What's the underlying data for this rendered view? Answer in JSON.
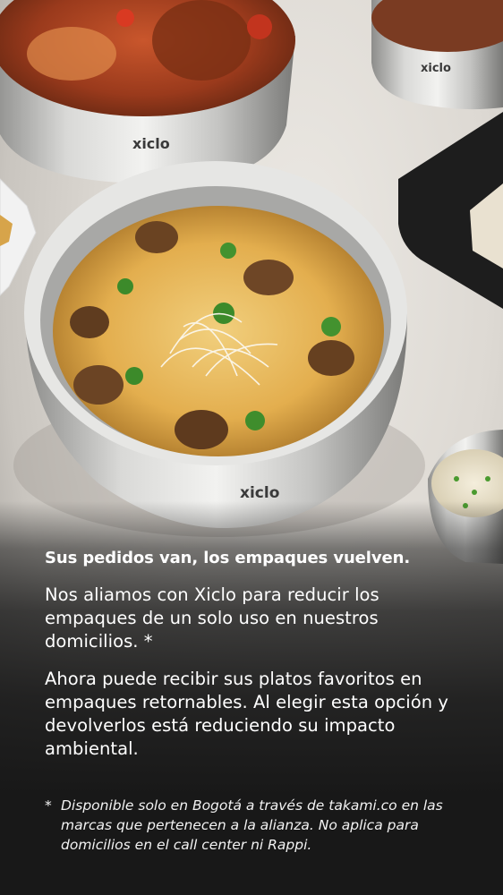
{
  "promo": {
    "headline": "Sus pedidos van, los empaques vuelven.",
    "paragraph1": "Nos aliamos con Xiclo para reducir los empaques de un solo uso en nuestros domicilios. *",
    "paragraph2": "Ahora puede recibir sus platos favoritos en empaques retornables. Al elegir esta opción y devolverlos está reduciendo su impacto ambiental.",
    "footnote_marker": "*",
    "footnote": "Disponible solo en Bogotá a través de takami.co en las marcas que pertenecen a la alianza. No aplica para domicilios en el call center ni Rappi."
  },
  "photo": {
    "bowl_brand": "xiclo"
  },
  "colors": {
    "text": "#ffffff",
    "overlay": "#1c1c1c",
    "steel": "#c8c8c6",
    "pasta": "#e8b85a"
  }
}
